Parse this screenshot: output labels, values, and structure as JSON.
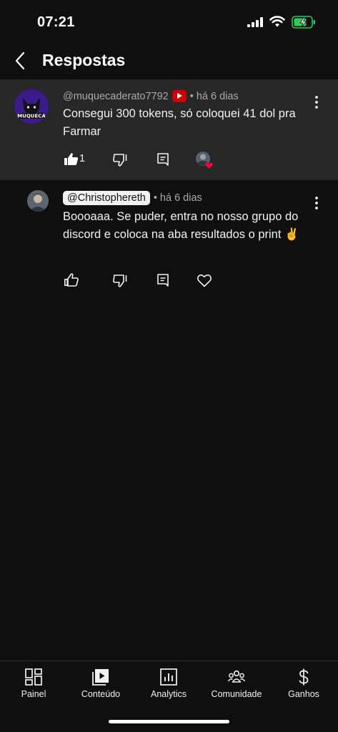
{
  "status_bar": {
    "time": "07:21"
  },
  "header": {
    "title": "Respostas",
    "back_icon": "chevron-left-icon"
  },
  "parent_comment": {
    "author": "@muquecaderato7792",
    "badge_icon": "youtube-creator-badge-icon",
    "time": "• há 6 dias",
    "text": "Consegui 300 tokens, só coloquei 41 dol pra Farmar",
    "like_count": "1",
    "avatar_text": "MUQUECA",
    "hearted": true
  },
  "reply": {
    "author": "@Christophereth",
    "time": "• há 6 dias",
    "text": "Boooaaa. Se puder, entra no nosso grupo do discord e coloca na aba resultados o print ✌️"
  },
  "bottom_nav": {
    "items": [
      {
        "label": "Painel",
        "icon": "dashboard-icon"
      },
      {
        "label": "Conteúdo",
        "icon": "content-icon"
      },
      {
        "label": "Analytics",
        "icon": "analytics-icon"
      },
      {
        "label": "Comunidade",
        "icon": "community-icon"
      },
      {
        "label": "Ganhos",
        "icon": "dollar-icon"
      }
    ]
  },
  "colors": {
    "background": "#0f0f0f",
    "highlight": "#272727",
    "youtube_red": "#cc0000",
    "heart_red": "#ff0033",
    "avatar_purple": "#3b1a8a"
  }
}
